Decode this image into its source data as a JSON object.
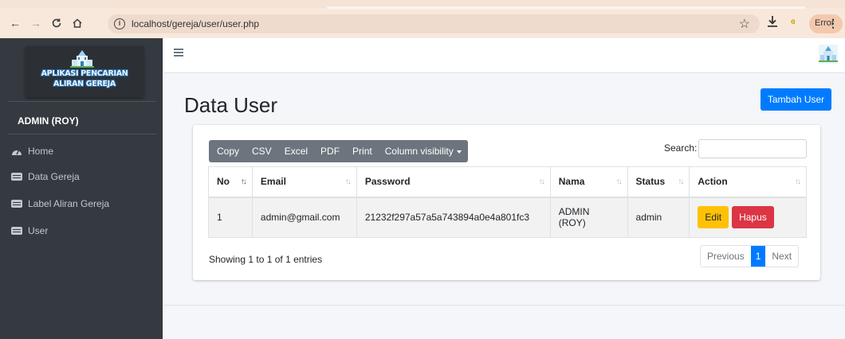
{
  "browser": {
    "url": "localhost/gereja/user/user.php",
    "error_label": "Error"
  },
  "sidebar": {
    "brand_line1": "APLIKASI PENCARIAN",
    "brand_line2": "ALIRAN GEREJA",
    "user": "ADMIN (ROY)",
    "items": [
      {
        "label": "Home",
        "icon": "tachometer-icon"
      },
      {
        "label": "Data Gereja",
        "icon": "list-icon"
      },
      {
        "label": "Label Aliran Gereja",
        "icon": "list-icon"
      },
      {
        "label": "User",
        "icon": "list-icon"
      }
    ]
  },
  "page": {
    "title": "Data User",
    "add_button": "Tambah User"
  },
  "toolbar": {
    "buttons": [
      "Copy",
      "CSV",
      "Excel",
      "PDF",
      "Print",
      "Column visibility"
    ],
    "search_label": "Search:",
    "search_value": ""
  },
  "table": {
    "columns": [
      "No",
      "Email",
      "Password",
      "Nama",
      "Status",
      "Action"
    ],
    "rows": [
      {
        "no": "1",
        "email": "admin@gmail.com",
        "password": "21232f297a57a5a743894a0e4a801fc3",
        "nama": "ADMIN (ROY)",
        "status": "admin",
        "edit": "Edit",
        "delete": "Hapus"
      }
    ]
  },
  "footer": {
    "info": "Showing 1 to 1 of 1 entries",
    "prev": "Previous",
    "page": "1",
    "next": "Next"
  },
  "colors": {
    "sidebar": "#343a40",
    "primary": "#007bff",
    "warning": "#ffc107",
    "danger": "#dc3545",
    "secondary": "#6c757d"
  }
}
